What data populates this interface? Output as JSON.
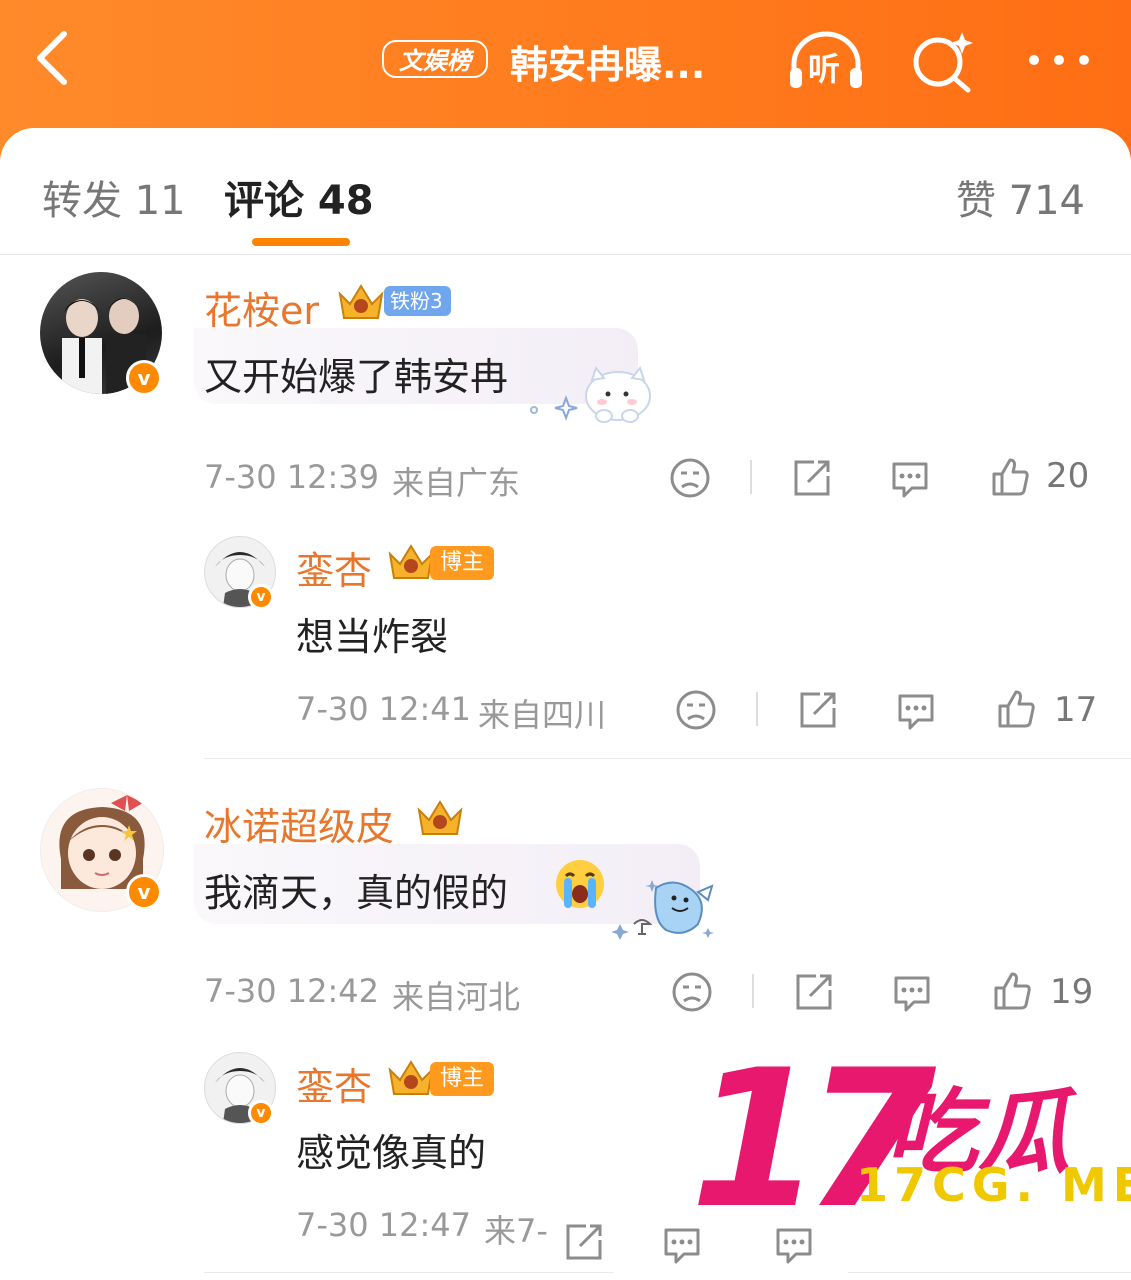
{
  "header": {
    "board_tag": "文娱榜",
    "title": "韩安冉曝...",
    "listen_label": "听"
  },
  "tabs": {
    "repost": "转发 11",
    "comment": "评论 48",
    "like": "赞 714"
  },
  "comments": [
    {
      "user": "花桉er",
      "badge": "铁粉3",
      "text": "又开始爆了韩安冉",
      "time": "7-30 12:39",
      "location": "来自广东",
      "likes": "20",
      "reply": {
        "user": "銮杏",
        "badge": "博主",
        "text": "想当炸裂",
        "time": "7-30 12:41",
        "location": "来自四川",
        "likes": "17"
      }
    },
    {
      "user": "冰诺超级皮",
      "text": "我滴天，真的假的",
      "time": "7-30 12:42",
      "location": "来自河北",
      "likes": "19",
      "reply": {
        "user": "銮杏",
        "badge": "博主",
        "text": "感觉像真的",
        "time": "7-30 12:47",
        "location": "来7-"
      }
    }
  ],
  "watermark": {
    "number": "17",
    "chars": "吃瓜",
    "url": "17CG. ME"
  },
  "colors": {
    "header_orange": "#ff7a1c",
    "username_orange": "#e8762d",
    "tab_underline": "#ff8200",
    "watermark_pink": "#e8186e",
    "watermark_yellow": "#f0c800"
  }
}
